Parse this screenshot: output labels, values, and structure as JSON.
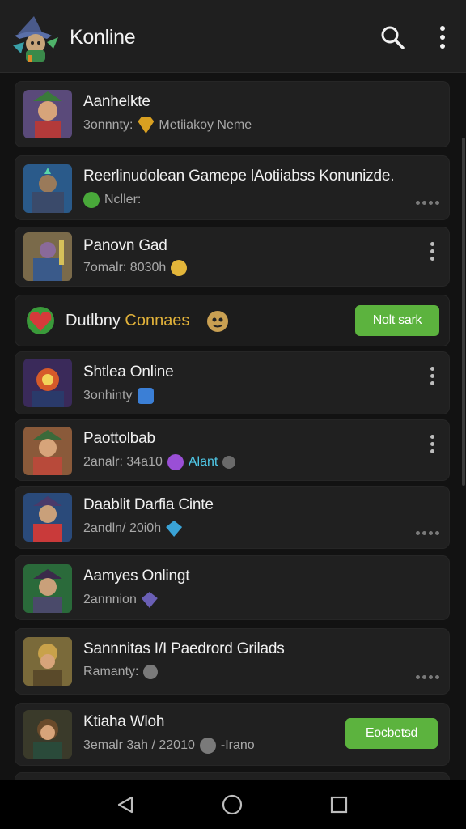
{
  "app": {
    "title": "Konline",
    "logo_icon": "wizard-mascot-icon"
  },
  "toolbar": {
    "search_icon": "search-icon",
    "menu_icon": "more-vert-icon"
  },
  "items": [
    {
      "title": "Aanhelkte",
      "subtitle": "3onnnty:",
      "subtitle_extra": "Metiiakoy Neme",
      "badge_color": "#d9a021"
    },
    {
      "title": "Reerlinudolean Gamepe lAotiiabss Konunizde.",
      "subtitle": "Ncller:",
      "badge_color": "#49a83a"
    },
    {
      "title": "Panovn Gad",
      "subtitle": "7omalr: 8030h",
      "badge_color": "#e3b63a"
    },
    {
      "title": "Shtlea Online",
      "subtitle": "3onhinty",
      "badge_color": "#3b7fd6"
    },
    {
      "title": "Paottolbab",
      "subtitle": "2analr: 34a10",
      "subtitle_extra": "Alant",
      "badge_color": "#9a4fd6",
      "extra_color": "#4fc9e8"
    },
    {
      "title": "Daablit Darfia Cinte",
      "subtitle": "2andln/ 20i0h",
      "badge_color": "#3aa3d6"
    },
    {
      "title": "Aamyes Onlingt",
      "subtitle": "2annnion",
      "badge_color": "#6a5fb5"
    },
    {
      "title": "Sannnitas I/I Paedrord Grilads",
      "subtitle": "Ramanty:",
      "badge_color": "#7a7a7a"
    },
    {
      "title": "Ktiaha Wloh",
      "subtitle": "3emalr 3ah / 22010",
      "subtitle_extra": "-Irano",
      "badge_color": "#7a7a7a"
    }
  ],
  "promo": {
    "label": "Dutlbny",
    "label_accent": "Connaes",
    "accent_color": "#e0b13a",
    "button": "Nolt sark"
  },
  "last_item_button": "Eocbetsd",
  "nav": {
    "back_icon": "back-triangle-icon",
    "home_icon": "home-circle-icon",
    "recents_icon": "recents-square-icon"
  },
  "colors": {
    "background": "#121212",
    "card": "#202020",
    "accent_green": "#5cb33e"
  }
}
